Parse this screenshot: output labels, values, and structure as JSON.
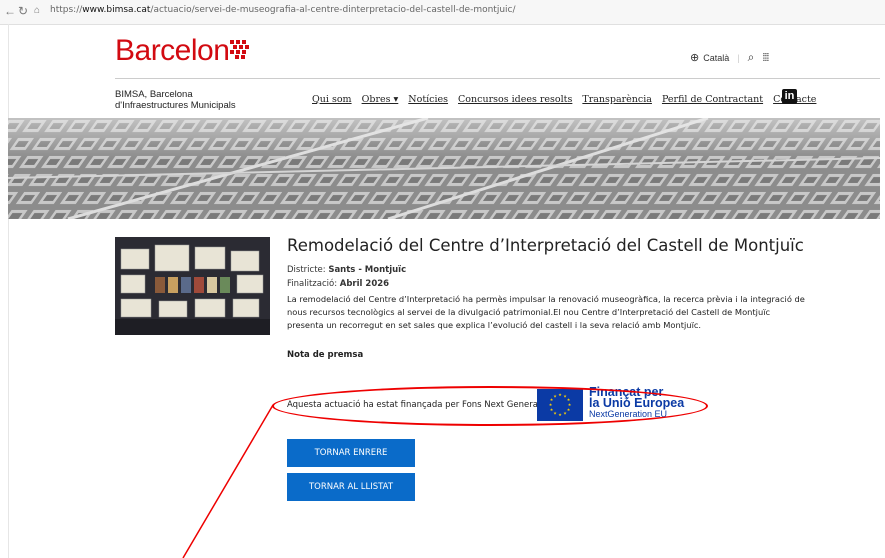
{
  "browser": {
    "url_prefix": "https://",
    "url_domain": "www.bimsa.cat",
    "url_path": "/actuacio/servei-de-museografia-al-centre-dinterpretacio-del-castell-de-montjuic/"
  },
  "header": {
    "logo": "Barcelona",
    "language": "Català",
    "org_line1": "BIMSA, Barcelona",
    "org_line2": "d'Infraestructures Municipals"
  },
  "menu": {
    "items": [
      "Qui som",
      "Obres ▾",
      "Notícies",
      "Concursos idees resolts",
      "Transparència",
      "Perfil de Contractant",
      "Contacte"
    ],
    "linkedin": "in"
  },
  "project": {
    "title": "Remodelació del Centre d’Interpretació del Castell de Montjuïc",
    "district_label": "Districte: ",
    "district": "Sants - Montjuïc",
    "finish_label": "Finalització: ",
    "finish": "Abril 2026",
    "description": "La remodelació del Centre d’Interpretació ha permès impulsar la renovació museogràfica, la recerca prèvia i la integració de nous recursos tecnològics al servei de la divulgació patrimonial.El nou Centre d’Interpretació del Castell de Montjuïc presenta un recorregut en set sales que explica l’evolució del castell i la seva relació amb Montjuïc.",
    "press_note": "Nota de premsa",
    "funding": "Aquesta actuació ha estat finançada per Fons Next Generation"
  },
  "eu": {
    "line1": "Finançat per",
    "line2": "la Unió Europea",
    "line3": "NextGeneration EU"
  },
  "buttons": {
    "back": "TORNAR ENRERE",
    "list": "TORNAR AL LLISTAT"
  },
  "colors": {
    "brand_red": "#d20a11",
    "button_blue": "#0a6bc9",
    "eu_blue": "#0b3aa5",
    "annotation_red": "#e00000"
  }
}
